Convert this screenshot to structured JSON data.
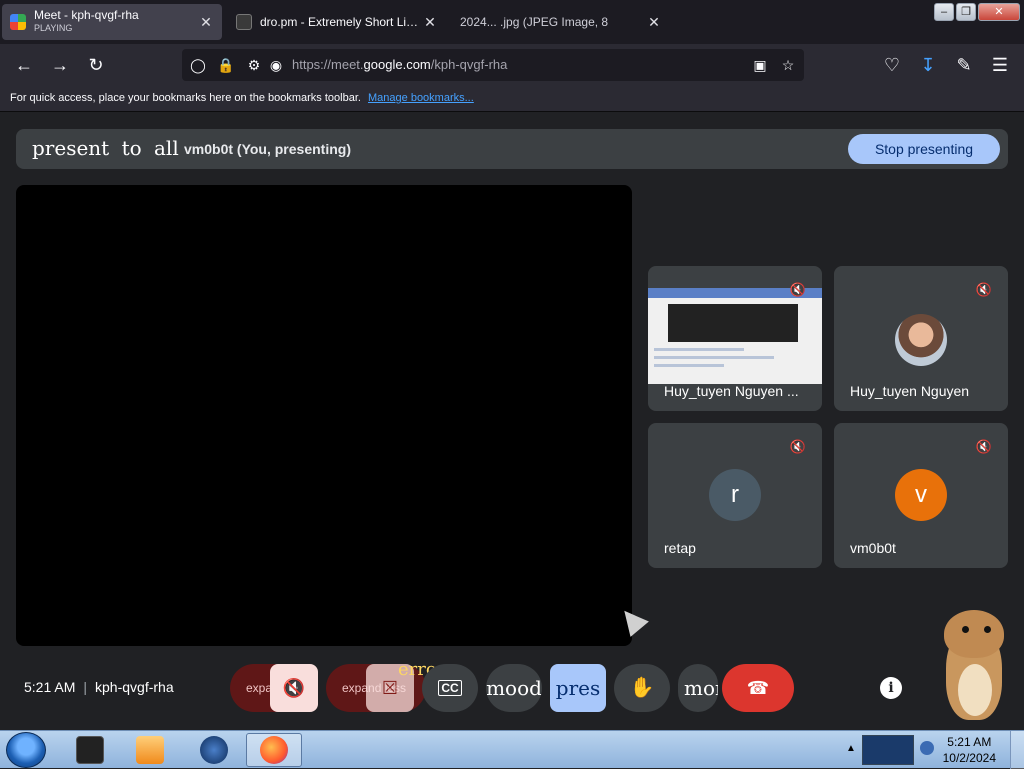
{
  "browser": {
    "tabs": [
      {
        "title": "Meet - kph-qvgf-rha",
        "subtitle": "PLAYING",
        "active": true
      },
      {
        "title": "dro.pm - Extremely Short Links",
        "active": false
      },
      {
        "title": "2024... .jpg (JPEG Image, 8",
        "active": false
      }
    ],
    "close_glyph": "✕",
    "window_buttons": {
      "minimize": "‒",
      "restore": "❐",
      "close": "✕"
    },
    "url_prefix": "https://meet.",
    "url_domain": "google.com",
    "url_path": "/kph-qvgf-rha",
    "bookmarks_text": "For quick access, place your bookmarks here on the bookmarks toolbar.",
    "bookmarks_link": "Manage bookmarks..."
  },
  "meet": {
    "present_title": "present to all",
    "present_who": "vm0b0t (You, presenting)",
    "stop_button": "Stop presenting",
    "participants": [
      {
        "name": "Huy_tuyen Nguyen ..."
      },
      {
        "name": "Huy_tuyen Nguyen"
      },
      {
        "name": "retap",
        "initial": "r",
        "color": "#4a5a66"
      },
      {
        "name": "vm0b0t",
        "initial": "v",
        "color": "#e8710a"
      }
    ],
    "time": "5:21 AM",
    "meeting_code": "kph-qvgf-rha",
    "controls": {
      "expand1": "expand",
      "expand2": "expand less",
      "error": "error",
      "cc": "CC",
      "mood": "mood",
      "present": "pres",
      "more": "mor"
    }
  },
  "taskbar": {
    "clock_time": "5:21 AM",
    "clock_date": "10/2/2024"
  },
  "colors": {
    "meet_bg": "#202124",
    "tile_bg": "#3c4043",
    "stop_button": "#a8c7fa",
    "end_call": "#dc362e"
  }
}
